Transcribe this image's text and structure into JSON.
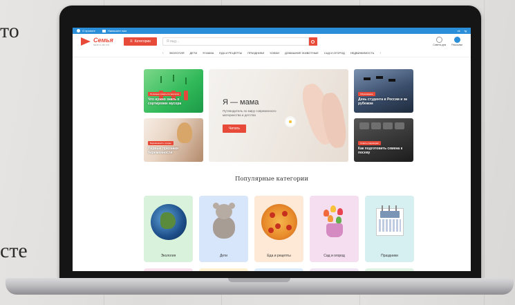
{
  "background": {
    "text_top": "то",
    "text_bottom": "сте"
  },
  "topbar": {
    "item1": "О проекте",
    "item2": "Напишите нам",
    "right1": "vk",
    "right2": "tg"
  },
  "header": {
    "logo_name": "Семья",
    "logo_sub": "SEMYA-RF.RU",
    "categories_label": "Категории",
    "search_placeholder": "Я ищу...",
    "action1": "Советы дня",
    "action2": "Рассылки"
  },
  "nav": {
    "items": [
      "ЭКОЛОГИЯ",
      "ДЕТИ",
      "Я МАМА",
      "ЕДА И РЕЦЕПТЫ",
      "ПРАЗДНИКИ",
      "ХОББИ",
      "ДОМАШНИЕ ЖИВОТНЫЕ",
      "САД И ОГОРОД",
      "НЕДВИЖИМОСТЬ"
    ]
  },
  "hero": {
    "card1": {
      "tag": "Полезные советы по экологии",
      "title": "Что нужно знать о сортировке мусора"
    },
    "card2": {
      "tag": "Беременность и роды",
      "title": "Первые признаки беременности"
    },
    "main": {
      "title": "Я — мама",
      "subtitle": "Путеводитель по миру современного материнства и детства",
      "button": "Читать"
    },
    "card4": {
      "tag": "Образование",
      "title": "День студента в России и за рубежом"
    },
    "card5": {
      "tag": "Советы садоводам",
      "title": "Как подготовить семена к посеву"
    }
  },
  "popular": {
    "title": "Популярные категории",
    "categories": [
      {
        "label": "Экология",
        "color": "#d8f2dc"
      },
      {
        "label": "Дети",
        "color": "#d8e6fb"
      },
      {
        "label": "Еда и рецепты",
        "color": "#fde9d5"
      },
      {
        "label": "Сад и огород",
        "color": "#f5def0"
      },
      {
        "label": "Праздники",
        "color": "#d6eff0"
      }
    ]
  },
  "colors": {
    "accent": "#e84a3a",
    "topbar": "#2a8fd8"
  }
}
